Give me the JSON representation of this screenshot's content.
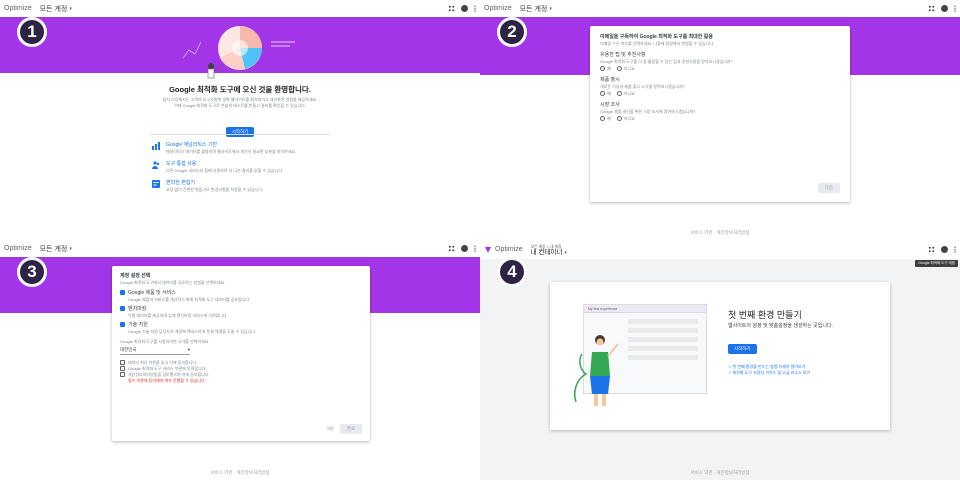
{
  "colors": {
    "purple_band": "#a335e8",
    "badge_bg": "#2d2345",
    "primary_blue": "#1a73e8"
  },
  "topbar": {
    "brand": "Optimize",
    "account": "모든 계정",
    "caret": "▾"
  },
  "footer": "서비스 약관 · 개인정보처리방침",
  "panel1": {
    "badge": "1",
    "welcome_title": "Google 최적화 도구에 오신 것을 환영합니다.",
    "intro": [
      "점차 다양해지는 고객의 요구사항에 맞춰 웹사이트를 최적화하고 개인화된 경험을 제공하세요.",
      "이제 Google 최적화 도구로 손쉽게 테스트를 만들고 결과를 확인할 수 있습니다."
    ],
    "start_button": "시작하기",
    "features": [
      {
        "title": "Google 애널리틱스 기반",
        "desc": "애널리틱스 데이터를 활용하여 웹사이트에서 개선이 필요한 부분을 파악하세요."
      },
      {
        "title": "도구 통합 사용",
        "desc": "다른 Google 서비스와 함께 사용하여 더 나은 결과를 얻을 수 있습니다."
      },
      {
        "title": "편리한 편집기",
        "desc": "코딩 없이 간편한 편집기로 변경사항을 적용할 수 있습니다."
      }
    ]
  },
  "panel2": {
    "badge": "2",
    "heading": "이메일을 구독하여 Google 최적화 도구를 최대한 활용",
    "sub": "이메일 수신 여부를 선택하세요. 나중에 설정에서 변경할 수 있습니다.",
    "sections": [
      {
        "title": "유용한 팁 및 추천사항",
        "desc": "Google 최적화 도구를 더 잘 활용할 수 있는 팁과 추천사항을 받아보시겠습니까?",
        "yes": "예",
        "no": "아니요"
      },
      {
        "title": "제품 출시",
        "desc": "새로운 기능과 제품 출시 소식을 받아보시겠습니까?",
        "yes": "예",
        "no": "아니요"
      },
      {
        "title": "시장 조사",
        "desc": "Google 제품 개선을 위한 시장 조사에 참여하시겠습니까?",
        "yes": "예",
        "no": "아니요"
      }
    ],
    "next_button": "다음"
  },
  "panel3": {
    "badge": "3",
    "heading": "계정 설정 선택",
    "sub": "Google 최적화 도구에서 데이터를 공유하는 방법을 선택하세요.",
    "options": [
      {
        "title": "Google 제품 및 서비스",
        "desc": "Google 제품과 서비스를 개선하기 위해 최적화 도구 데이터를 공유합니다.",
        "checked": true
      },
      {
        "title": "벤치마킹",
        "desc": "익명 데이터를 제공하여 업계 벤치마킹 서비스에 기여합니다.",
        "checked": true
      },
      {
        "title": "기술 지원",
        "desc": "Google 기술 지원 담당자가 계정에 액세스하여 문제 해결을 도울 수 있습니다.",
        "checked": true
      }
    ],
    "country_label": "Google 최적화 도구를 사용하려면 국가를 선택하세요.",
    "country_value": "대한민국",
    "agreements": [
      "데이터 처리 약관을 읽고 이에 동의합니다.",
      "Google 최적화 도구 서비스 약관에 동의합니다.",
      "개인정보처리방침을 검토했으며 이에 동의합니다."
    ],
    "warning": "필수 약관에 동의해야 계속 진행할 수 있습니다.",
    "back_button": "이전",
    "finish_button": "완료"
  },
  "panel4": {
    "badge": "4",
    "breadcrumb": "모든 계정 > 내 계정",
    "container_title": "내 컨테이너",
    "tooltip": "Google 최적화 도구 계정",
    "mock_title": "My first experience",
    "empty_title": "첫 번째 환경 만들기",
    "empty_sub": "웹사이트의 설정 및 맞춤설정을 생성하는 곳입니다.",
    "get_started": "시작하기",
    "help_links": [
      "첫 번째 환경을 만드는 방법 자세히 알아보기",
      "최적화 도구 사용자 가이드 및 고급 리소스 보기"
    ]
  }
}
